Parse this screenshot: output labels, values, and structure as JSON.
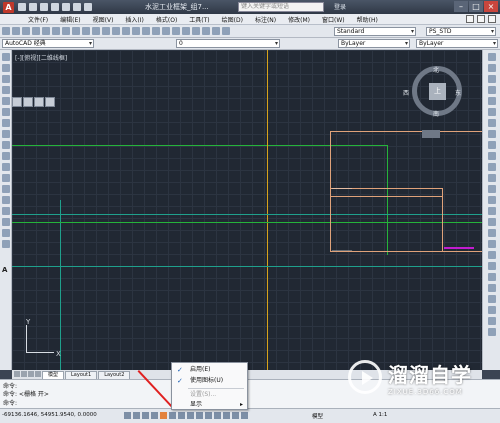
{
  "window": {
    "app_logo": "A",
    "title": "水泥工业框架_组7...",
    "search_placeholder": "键入关键字或短语",
    "login": "登录"
  },
  "menu": [
    "文件(F)",
    "编辑(E)",
    "视图(V)",
    "插入(I)",
    "格式(O)",
    "工具(T)",
    "绘图(D)",
    "标注(N)",
    "修改(M)",
    "窗口(W)",
    "帮助(H)"
  ],
  "toolbar": {
    "workspace": "AutoCAD 经典",
    "layer": "0",
    "text_style": "Standard",
    "plot_style": "PS_STD",
    "color": "ByLayer",
    "linetype": "ByLayer",
    "lineweight": "ByLayer"
  },
  "viewport": {
    "label": "[-][俯视][二维线框]",
    "viewcube": {
      "north": "北",
      "south": "南",
      "west": "西",
      "east": "东",
      "face": "上"
    },
    "ucs_x": "X",
    "ucs_y": "Y"
  },
  "tabs": [
    "模型",
    "Layout1",
    "Layout2"
  ],
  "command": {
    "line1": "命令:",
    "line2": "命令: <栅格 开>",
    "line3": "命令:"
  },
  "status": {
    "coords": "-69136.1646, 54951.9540, 0.0000",
    "model": "模型",
    "scale": "A 1:1"
  },
  "context_menu": [
    {
      "label": "启用(E)",
      "checked": true,
      "disabled": false
    },
    {
      "label": "使用图标(U)",
      "checked": true,
      "disabled": false
    },
    {
      "label": "设置(S)...",
      "checked": false,
      "disabled": true
    },
    {
      "label": "显示",
      "checked": false,
      "disabled": false,
      "submenu": true
    }
  ],
  "watermark": {
    "name": "溜溜自学",
    "url": "ZIXUE.3D66.COM"
  },
  "colors": {
    "canvas": "#212833",
    "grid": "#2c3441",
    "green_line": "#25b33a",
    "cyan_line": "#1fa08c",
    "yellow_line": "#d7a21a",
    "salmon_line": "#e0a27a",
    "magenta_mark": "#c21ccf",
    "annotation_arrow": "#e02020"
  }
}
